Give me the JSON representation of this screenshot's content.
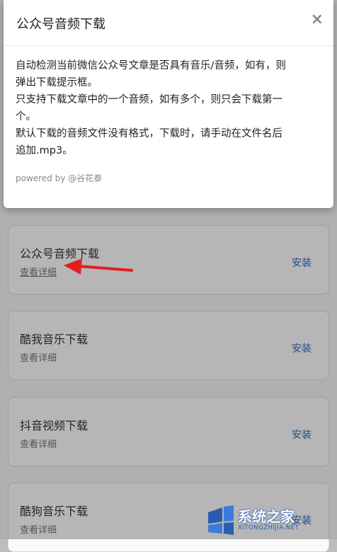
{
  "modal": {
    "title": "公众号音频下载",
    "close_icon": "×",
    "lines": [
      "自动检测当前微信公众号文章是否具有音乐/音频，如有，则",
      "弹出下载提示框。",
      "只支持下载文章中的一个音频，如有多个，则只会下载第一",
      "个。",
      "默认下载的音频文件没有格式，下载时，请手动在文件名后",
      "追加.mp3。"
    ],
    "footer": "powered by @谷花泰"
  },
  "scripts": [
    {
      "title": "公众号音频下载",
      "detail": "查看详细",
      "install": "安装"
    },
    {
      "title": "酷我音乐下载",
      "detail": "查看详细",
      "install": "安装"
    },
    {
      "title": "抖音视频下载",
      "detail": "查看详细",
      "install": "安装"
    },
    {
      "title": "酷狗音乐下载",
      "detail": "查看详细",
      "install": "安装"
    }
  ],
  "annotation": {
    "arrow_color": "#e02020"
  },
  "watermark": {
    "name": "系统之家",
    "url": "XITONGZHIJIA.NET"
  }
}
